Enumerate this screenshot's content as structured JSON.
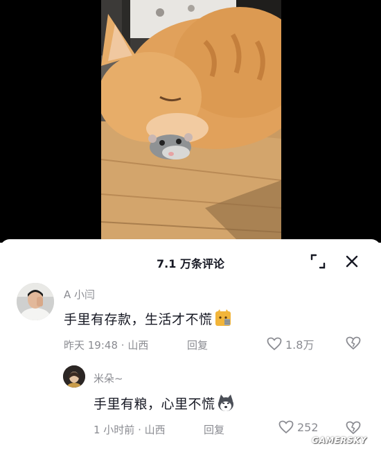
{
  "video": {
    "description_icon": "cat-and-hamster-video"
  },
  "comments_header": {
    "title": "7.1 万条评论",
    "expand_icon": "expand-icon",
    "close_icon": "close-icon"
  },
  "comments": [
    {
      "username": "A 小闫",
      "text": "手里有存款，生活才不慌",
      "emoji": "cat-emoji",
      "time": "昨天 19:48",
      "separator": "·",
      "location": "山西",
      "reply_label": "回复",
      "likes": "1.8万"
    },
    {
      "username": "米朵~",
      "text": "手里有粮，心里不慌",
      "emoji": "husky-emoji",
      "time": "1 小时前",
      "separator": "·",
      "location": "山西",
      "reply_label": "回复",
      "likes": "252"
    }
  ],
  "watermark": "GAMERSKY",
  "colors": {
    "text_primary": "#161823",
    "text_secondary": "#8a8b91",
    "video_background": "#000000"
  }
}
